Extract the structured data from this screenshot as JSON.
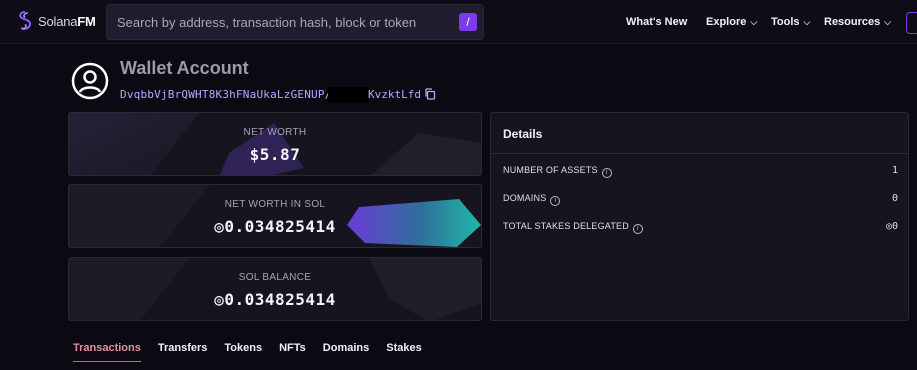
{
  "header": {
    "logo_text_a": "Solana",
    "logo_text_b": "FM",
    "search_placeholder": "Search by address, transaction hash, block or token",
    "search_shortcut": "/",
    "nav": {
      "whats_new": "What's New",
      "explore": "Explore",
      "tools": "Tools",
      "resources": "Resources"
    }
  },
  "account": {
    "title": "Wallet Account",
    "address_visible_start": "DvqbbVjBrQWHT8K3hFNaUkaLzGENUP/",
    "address_visible_end": "KvzktLfd"
  },
  "cards": {
    "net_worth_label": "NET WORTH",
    "net_worth_value": "$5.87",
    "net_worth_sol_label": "NET WORTH IN SOL",
    "net_worth_sol_value": "◎0.034825414",
    "sol_balance_label": "SOL BALANCE",
    "sol_balance_value": "◎0.034825414"
  },
  "details": {
    "title": "Details",
    "rows": [
      {
        "label": "NUMBER OF ASSETS",
        "value": "1"
      },
      {
        "label": "DOMAINS",
        "value": "0"
      },
      {
        "label": "TOTAL STAKES DELEGATED",
        "value": "◎0"
      }
    ]
  },
  "tabs": [
    "Transactions",
    "Transfers",
    "Tokens",
    "NFTs",
    "Domains",
    "Stakes"
  ],
  "colors": {
    "background": "#0b0a12",
    "accent_purple": "#7c3aed",
    "address_link": "#b9a7ff",
    "active_tab": "#e98ea0"
  }
}
